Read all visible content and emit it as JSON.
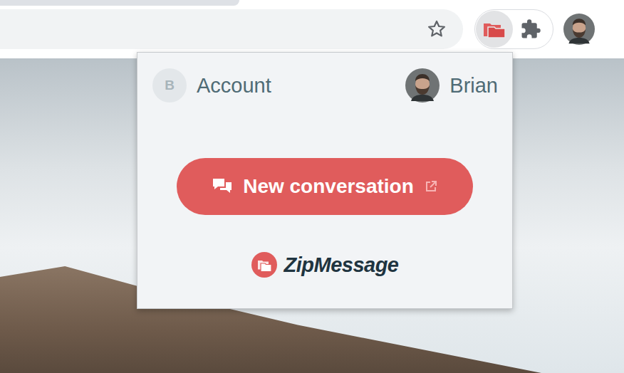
{
  "account": {
    "initial": "B",
    "label": "Account"
  },
  "user": {
    "name": "Brian"
  },
  "action": {
    "label": "New conversation"
  },
  "brand": {
    "name": "ZipMessage"
  }
}
